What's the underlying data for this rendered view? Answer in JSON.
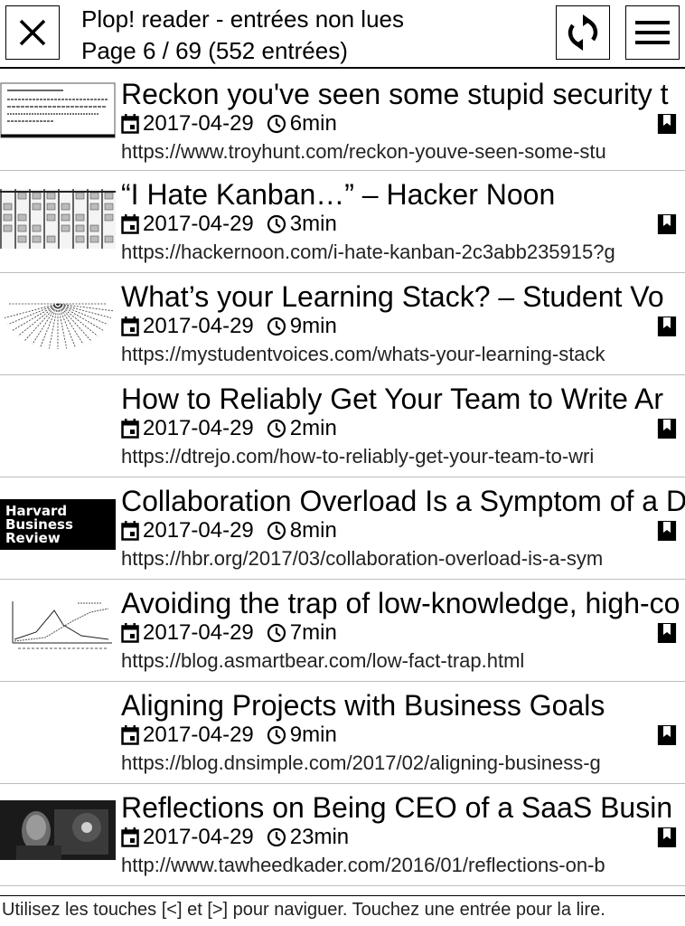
{
  "header": {
    "title_line1": "Plop! reader - entrées non lues",
    "title_line2": "Page 6 / 69 (552 entrées)",
    "close_icon": "close-icon",
    "refresh_icon": "refresh-icon",
    "menu_icon": "menu-icon"
  },
  "entries": [
    {
      "title": "Reckon you've seen some stupid security t",
      "date": "2017-04-29",
      "duration": "6min",
      "url": "https://www.troyhunt.com/reckon-youve-seen-some-stu",
      "thumbnail": "screenshot-text"
    },
    {
      "title": "“I Hate Kanban…” – Hacker Noon",
      "date": "2017-04-29",
      "duration": "3min",
      "url": "https://hackernoon.com/i-hate-kanban-2c3abb235915?g",
      "thumbnail": "kanban-board"
    },
    {
      "title": "What’s your Learning Stack? – Student Vo",
      "date": "2017-04-29",
      "duration": "9min",
      "url": "https://mystudentvoices.com/whats-your-learning-stack",
      "thumbnail": "mind-map"
    },
    {
      "title": "How to Reliably Get Your Team to Write Ar",
      "date": "2017-04-29",
      "duration": "2min",
      "url": "https://dtrejo.com/how-to-reliably-get-your-team-to-wri",
      "thumbnail": "none"
    },
    {
      "title": "Collaboration Overload Is a Symptom of a D",
      "date": "2017-04-29",
      "duration": "8min",
      "url": "https://hbr.org/2017/03/collaboration-overload-is-a-sym",
      "thumbnail": "hbr-logo",
      "thumb_text": [
        "Harvard",
        "Business",
        "Review"
      ]
    },
    {
      "title": "Avoiding the trap of low-knowledge, high-co",
      "date": "2017-04-29",
      "duration": "7min",
      "url": "https://blog.asmartbear.com/low-fact-trap.html",
      "thumbnail": "line-chart"
    },
    {
      "title": "Aligning Projects with Business Goals",
      "date": "2017-04-29",
      "duration": "9min",
      "url": "https://blog.dnsimple.com/2017/02/aligning-business-g",
      "thumbnail": "none"
    },
    {
      "title": "Reflections on Being CEO of a SaaS Busin",
      "date": "2017-04-29",
      "duration": "23min",
      "url": "http://www.tawheedkader.com/2016/01/reflections-on-b",
      "thumbnail": "photo"
    }
  ],
  "footer": {
    "hint": "Utilisez les touches [<] et [>] pour naviguer. Touchez une entrée pour la lire."
  },
  "icons": {
    "date": "calendar-icon",
    "duration": "clock-icon",
    "bookmark": "bookmark-icon"
  }
}
